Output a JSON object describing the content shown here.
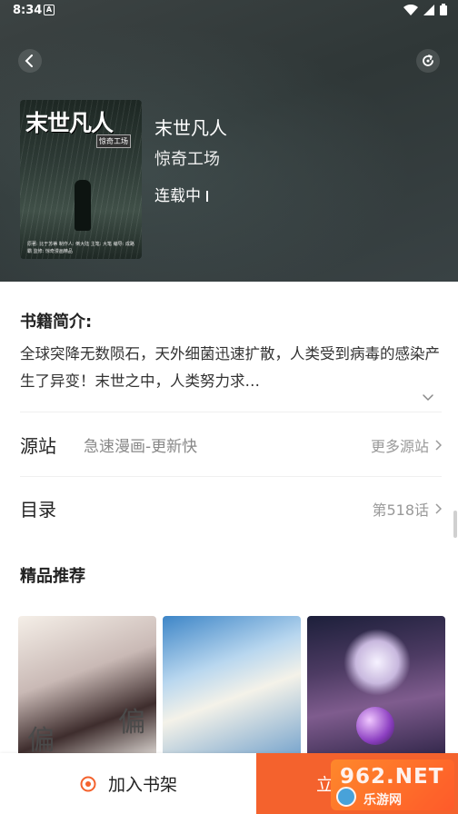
{
  "status_bar": {
    "time": "8:34",
    "notif_icon": "A"
  },
  "header": {
    "back_icon": "chevron-left-icon",
    "refresh_icon": "refresh-icon"
  },
  "book": {
    "cover_title": "末世凡人",
    "cover_subtitle": "惊奇工场",
    "cover_credits": "原著: 比于苏蒂  制作人: 倒大陆  主笔: 大笔  编导: 成路霸  监修: 惊奇漫画精品",
    "title": "末世凡人",
    "author": "惊奇工场",
    "status": "连载中"
  },
  "intro": {
    "heading": "书籍简介:",
    "text": "全球突降无数陨石，天外细菌迅速扩散，人类受到病毒的感染产生了异变！末世之中，人类努力求…"
  },
  "source_row": {
    "label": "源站",
    "value": "急速漫画-更新快",
    "action": "更多源站"
  },
  "toc_row": {
    "label": "目录",
    "action": "第518话"
  },
  "recommend": {
    "heading": "精品推荐",
    "items": [
      {
        "cover_text_a": "偏",
        "cover_text_b": "偏"
      },
      {
        "cover_text_a": "",
        "cover_text_b": ""
      },
      {
        "cover_text_a": "",
        "cover_text_b": ""
      }
    ]
  },
  "bottom_bar": {
    "add_shelf": "加入书架",
    "read_now": "立"
  },
  "watermark": {
    "main": "962.NET",
    "sub": "乐游网"
  },
  "colors": {
    "accent": "#f4622d",
    "header_bg": "#343c3c"
  }
}
